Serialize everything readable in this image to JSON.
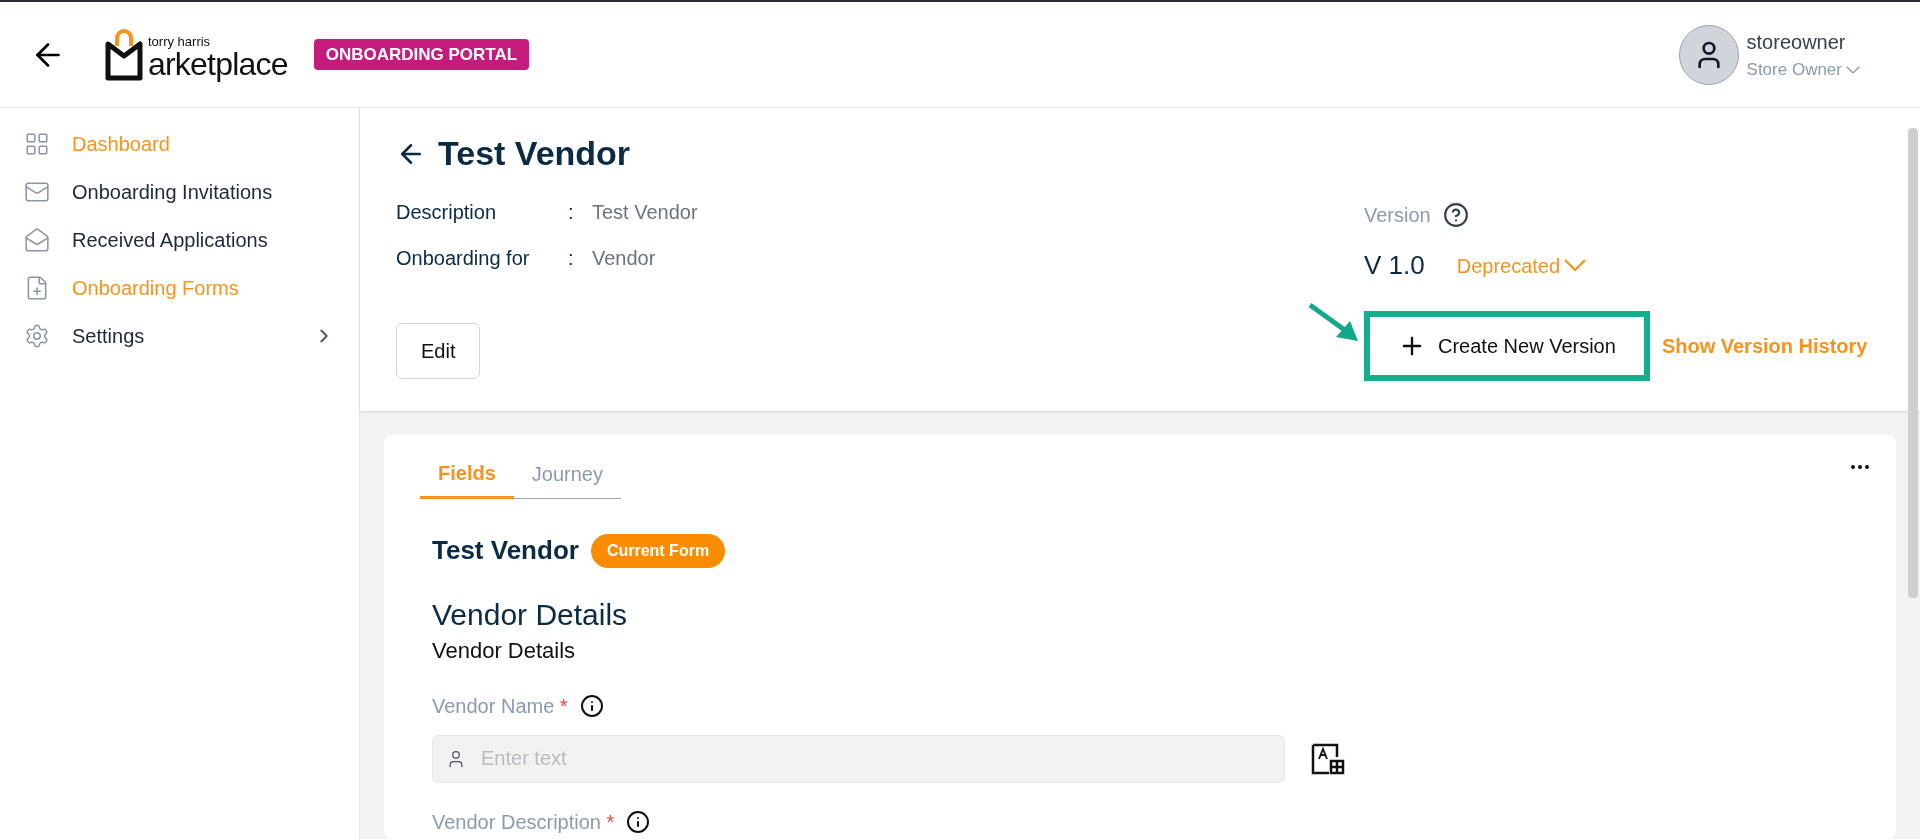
{
  "header": {
    "logo_small": "torry harris",
    "logo_main": "arketplace",
    "portal_badge": "ONBOARDING PORTAL",
    "user": {
      "name": "storeowner",
      "role": "Store Owner"
    }
  },
  "sidebar": {
    "items": [
      {
        "label": "Dashboard",
        "selected": true,
        "expandable": false
      },
      {
        "label": "Onboarding Invitations",
        "selected": false,
        "expandable": false
      },
      {
        "label": "Received Applications",
        "selected": false,
        "expandable": false
      },
      {
        "label": "Onboarding Forms",
        "selected": true,
        "expandable": false
      },
      {
        "label": "Settings",
        "selected": false,
        "expandable": true
      }
    ]
  },
  "detail": {
    "title": "Test Vendor",
    "fields": [
      {
        "label": "Description",
        "separator": ":",
        "value": "Test Vendor"
      },
      {
        "label": "Onboarding for",
        "separator": ":",
        "value": "Vendor"
      }
    ],
    "version_label": "Version",
    "version": "V 1.0",
    "status": "Deprecated",
    "edit_button": "Edit",
    "create_button": "Create New Version",
    "create_highlighted": true,
    "history_link": "Show Version History"
  },
  "form_card": {
    "tabs": [
      {
        "label": "Fields",
        "selected": true
      },
      {
        "label": "Journey",
        "selected": false
      }
    ],
    "form_title": "Test Vendor",
    "form_badge": "Current Form",
    "section_title": "Vendor Details",
    "section_subtitle": "Vendor Details",
    "fields": [
      {
        "label": "Vendor Name",
        "required_mark": "*",
        "placeholder": "Enter text",
        "kind": "text"
      },
      {
        "label": "Vendor Description",
        "required_mark": "*",
        "kind": "label_only"
      }
    ]
  }
}
